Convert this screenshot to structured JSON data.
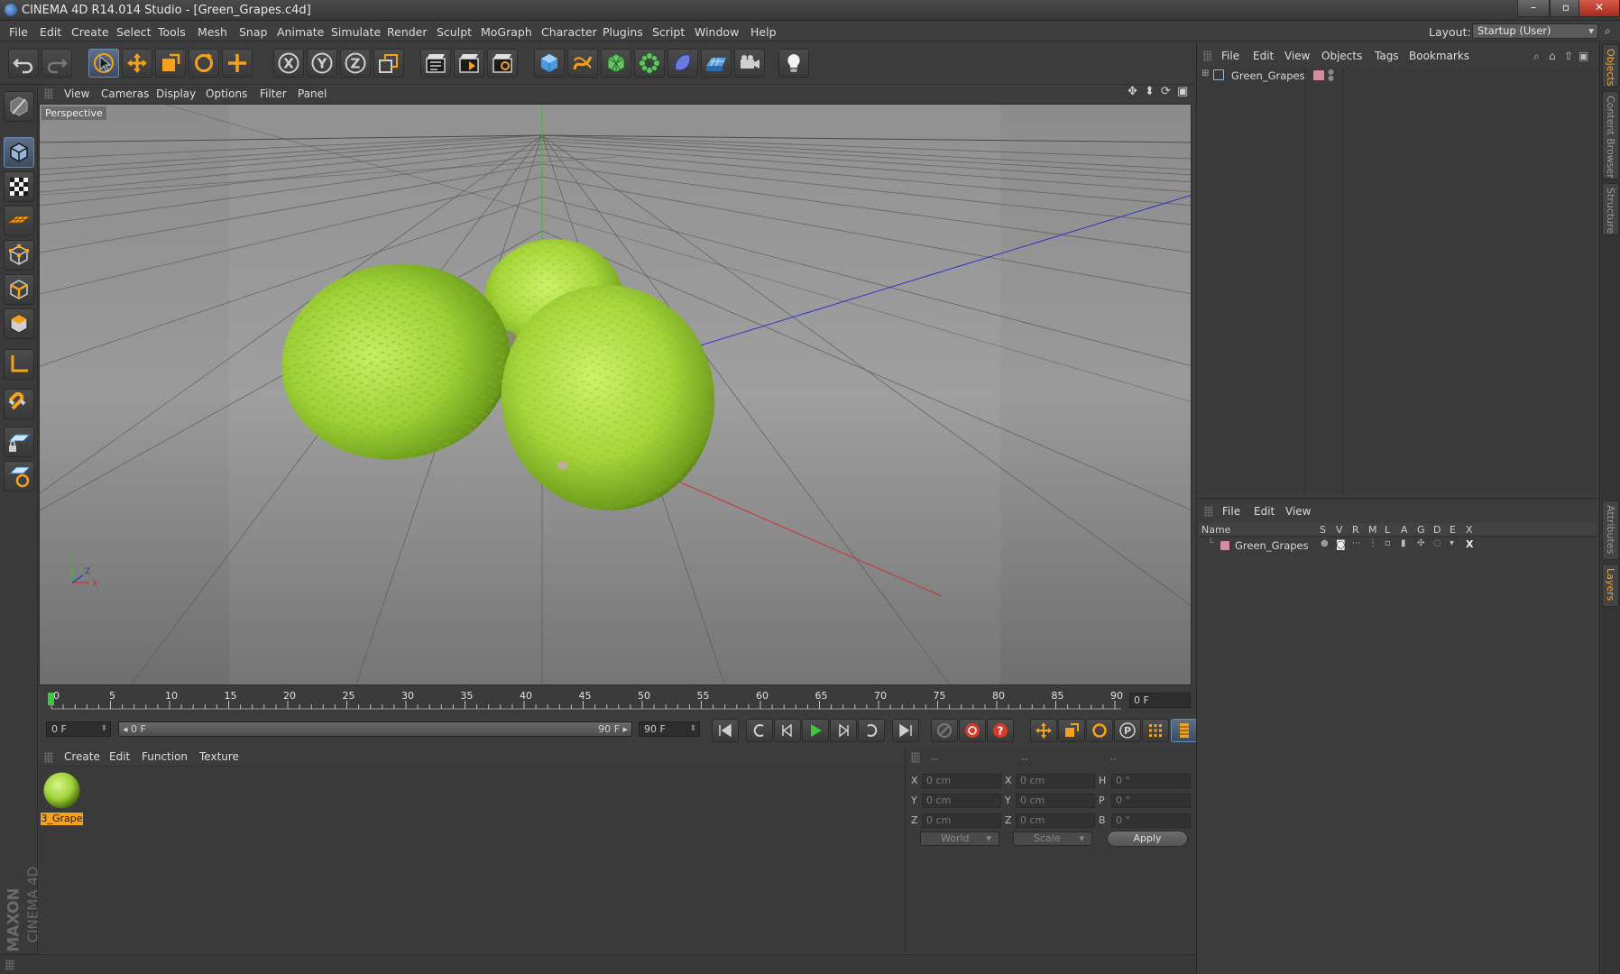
{
  "window": {
    "title": "CINEMA 4D R14.014 Studio - [Green_Grapes.c4d]",
    "minimize": "–",
    "maximize": "▫",
    "close": "✕"
  },
  "menubar": {
    "items": [
      "File",
      "Edit",
      "Create",
      "Select",
      "Tools",
      "Mesh",
      "Snap",
      "Animate",
      "Simulate",
      "Render",
      "Sculpt",
      "MoGraph",
      "Character",
      "Plugins",
      "Script",
      "Window",
      "Help"
    ],
    "layout_label": "Layout:",
    "layout_value": "Startup (User)"
  },
  "toolbar": {
    "icons": [
      "undo-icon",
      "redo-icon",
      "live-selection-icon",
      "move-icon",
      "scale-icon",
      "rotate-icon",
      "add-object-icon",
      "x-axis-icon",
      "y-axis-icon",
      "z-axis-icon",
      "coordinate-system-icon",
      "render-view-icon",
      "render-picture-viewer-icon",
      "edit-render-settings-icon",
      "cube-icon",
      "spline-pen-icon",
      "subdivision-icon",
      "array-icon",
      "deformer-icon",
      "floor-icon",
      "camera-icon",
      "light-icon"
    ]
  },
  "leftbar": {
    "icons": [
      "make-editable-icon",
      "model-mode-icon",
      "texture-mode-icon",
      "workplane-icon",
      "points-mode-icon",
      "edges-mode-icon",
      "polygons-mode-icon",
      "axis-mode-icon",
      "snap-magnet-icon",
      "locked-workplane-icon",
      "animation-icon"
    ],
    "logo_brand": "MAXON",
    "logo_product": "CINEMA 4D"
  },
  "viewport": {
    "menu": [
      "View",
      "Cameras",
      "Display",
      "Options",
      "Filter",
      "Panel"
    ],
    "camera_label": "Perspective",
    "axis_y": "Y",
    "axis_z": "Z",
    "axis_x": "X"
  },
  "timeline": {
    "ticks": [
      "0",
      "5",
      "10",
      "15",
      "20",
      "25",
      "30",
      "35",
      "40",
      "45",
      "50",
      "55",
      "60",
      "65",
      "70",
      "75",
      "80",
      "85",
      "90"
    ],
    "current_frame_field": "0 F"
  },
  "transport": {
    "start_field": "0 F",
    "range_start": "◂ 0 F",
    "range_end": "90 F ▸",
    "end_field": "90 F",
    "buttons": [
      "go-to-start-icon",
      "previous-keyframe-icon",
      "step-back-icon",
      "play-icon",
      "step-forward-icon",
      "next-keyframe-icon",
      "go-to-end-icon",
      "record-off-icon",
      "record-active-icon",
      "autokey-help-icon",
      "key-position-icon",
      "key-scale-icon",
      "key-rotation-icon",
      "key-parameter-icon",
      "key-pla-icon",
      "timeline-icon"
    ]
  },
  "materials": {
    "menu": [
      "Create",
      "Edit",
      "Function",
      "Texture"
    ],
    "items": [
      {
        "label": "3_Grape"
      }
    ]
  },
  "coordinates": {
    "header": [
      "--",
      "--",
      "--"
    ],
    "rows": [
      {
        "label1": "X",
        "pos": "0 cm",
        "label2": "X",
        "size": "0 cm",
        "label3": "H",
        "rot": "0 °"
      },
      {
        "label1": "Y",
        "pos": "0 cm",
        "label2": "Y",
        "size": "0 cm",
        "label3": "P",
        "rot": "0 °"
      },
      {
        "label1": "Z",
        "pos": "0 cm",
        "label2": "Z",
        "size": "0 cm",
        "label3": "B",
        "rot": "0 °"
      }
    ],
    "coord_system": "World",
    "size_mode": "Scale",
    "apply": "Apply"
  },
  "objects": {
    "menu": [
      "File",
      "Edit",
      "View",
      "Objects",
      "Tags",
      "Bookmarks"
    ],
    "items": [
      {
        "name": "Green_Grapes"
      }
    ]
  },
  "layers": {
    "menu": [
      "File",
      "Edit",
      "View"
    ],
    "columns": [
      "Name",
      "S",
      "V",
      "R",
      "M",
      "L",
      "A",
      "G",
      "D",
      "E",
      "X"
    ],
    "items": [
      {
        "name": "Green_Grapes",
        "color": "#d88a9e"
      }
    ]
  },
  "side_tabs": [
    "Objects",
    "Content Browser",
    "Structure",
    "Attributes",
    "Layers"
  ],
  "colors": {
    "accent": "#f4a21a",
    "grape": "#9fd237",
    "selection_blue": "#5e6f86"
  }
}
